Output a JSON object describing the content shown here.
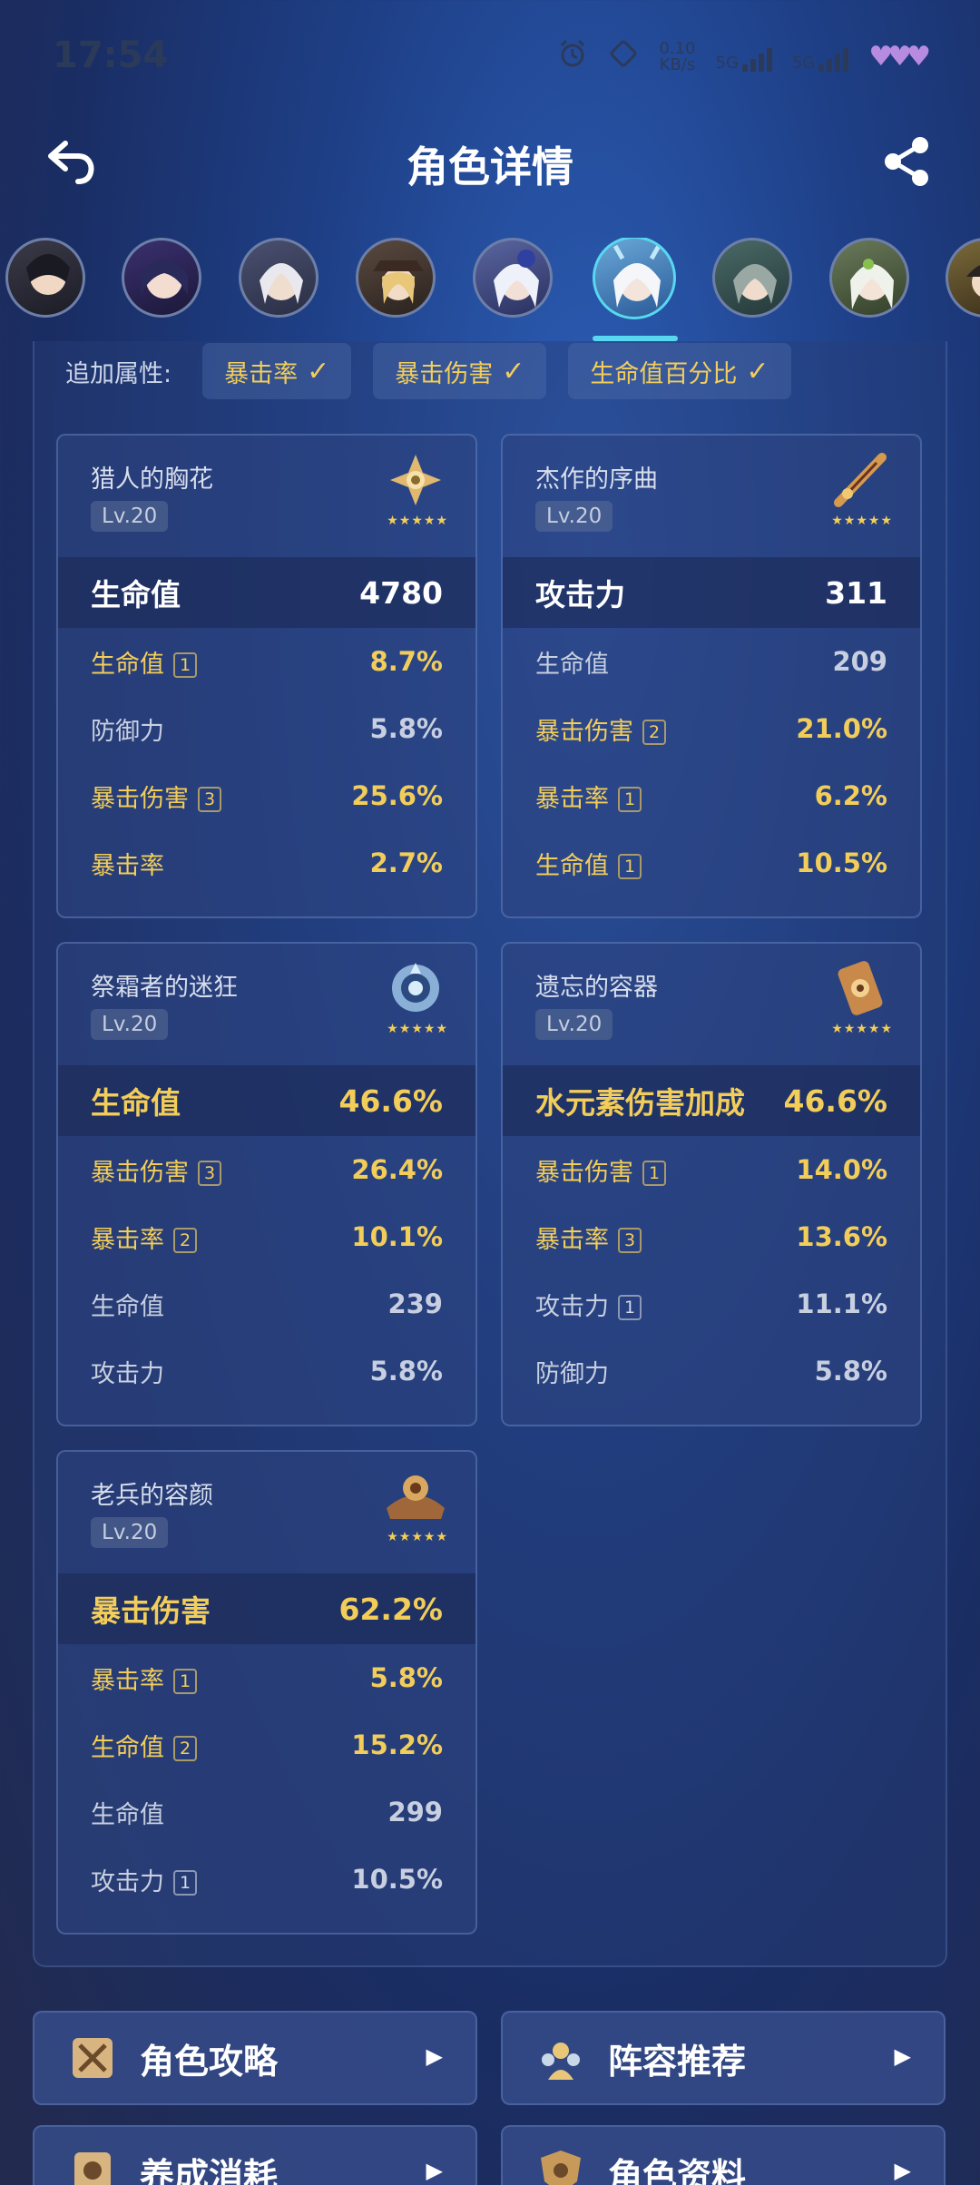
{
  "status": {
    "time": "17:54",
    "net_speed_value": "0.10",
    "net_speed_unit": "KB/s",
    "sig1": "5G",
    "sig2": "5G"
  },
  "header": {
    "title": "角色详情"
  },
  "extra": {
    "label": "追加属性:",
    "chips": [
      "暴击率",
      "暴击伤害",
      "生命值百分比"
    ],
    "check": "✓"
  },
  "cards": [
    {
      "name": "猎人的胸花",
      "level": "Lv.20",
      "stars": "★★★★★",
      "main": {
        "k": "生命值",
        "v": "4780"
      },
      "subs": [
        {
          "k": "生命值",
          "badge": "1",
          "v": "8.7%"
        },
        {
          "k": "防御力",
          "badge": "",
          "v": "5.8%"
        },
        {
          "k": "暴击伤害",
          "badge": "3",
          "v": "25.6%"
        },
        {
          "k": "暴击率",
          "badge": "",
          "v": "2.7%"
        }
      ]
    },
    {
      "name": "杰作的序曲",
      "level": "Lv.20",
      "stars": "★★★★★",
      "main": {
        "k": "攻击力",
        "v": "311"
      },
      "subs": [
        {
          "k": "生命值",
          "badge": "",
          "v": "209"
        },
        {
          "k": "暴击伤害",
          "badge": "2",
          "v": "21.0%"
        },
        {
          "k": "暴击率",
          "badge": "1",
          "v": "6.2%"
        },
        {
          "k": "生命值",
          "badge": "1",
          "v": "10.5%"
        }
      ]
    },
    {
      "name": "祭霜者的迷狂",
      "level": "Lv.20",
      "stars": "★★★★★",
      "main": {
        "k": "生命值",
        "v": "46.6%"
      },
      "subs": [
        {
          "k": "暴击伤害",
          "badge": "3",
          "v": "26.4%"
        },
        {
          "k": "暴击率",
          "badge": "2",
          "v": "10.1%"
        },
        {
          "k": "生命值",
          "badge": "",
          "v": "239"
        },
        {
          "k": "攻击力",
          "badge": "",
          "v": "5.8%"
        }
      ]
    },
    {
      "name": "遗忘的容器",
      "level": "Lv.20",
      "stars": "★★★★★",
      "main": {
        "k": "水元素伤害加成",
        "v": "46.6%"
      },
      "subs": [
        {
          "k": "暴击伤害",
          "badge": "1",
          "v": "14.0%"
        },
        {
          "k": "暴击率",
          "badge": "3",
          "v": "13.6%"
        },
        {
          "k": "攻击力",
          "badge": "1",
          "v": "11.1%"
        },
        {
          "k": "防御力",
          "badge": "",
          "v": "5.8%"
        }
      ]
    },
    {
      "name": "老兵的容颜",
      "level": "Lv.20",
      "stars": "★★★★★",
      "main": {
        "k": "暴击伤害",
        "v": "62.2%"
      },
      "subs": [
        {
          "k": "暴击率",
          "badge": "1",
          "v": "5.8%"
        },
        {
          "k": "生命值",
          "badge": "2",
          "v": "15.2%"
        },
        {
          "k": "生命值",
          "badge": "",
          "v": "299"
        },
        {
          "k": "攻击力",
          "badge": "1",
          "v": "10.5%"
        }
      ]
    }
  ],
  "bottom": {
    "guide": "角色攻略",
    "team": "阵容推荐",
    "cost": "养成消耗",
    "profile": "角色资料",
    "arrow": "▶"
  }
}
